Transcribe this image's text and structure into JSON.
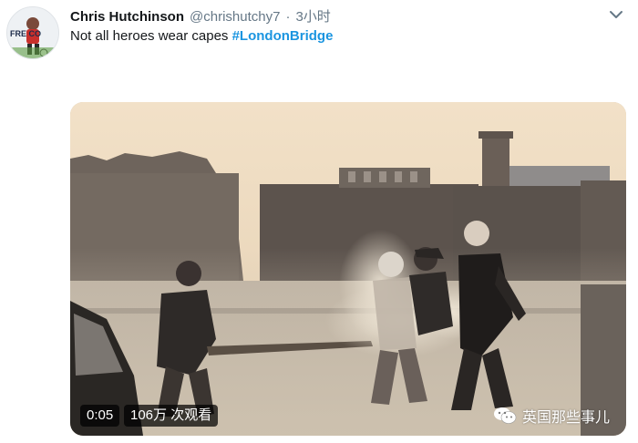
{
  "tweet": {
    "display_name": "Chris Hutchinson",
    "handle": "@chrishutchy7",
    "separator": "·",
    "timestamp": "3小时",
    "text": "Not all heroes wear capes ",
    "hashtag": "#LondonBridge"
  },
  "avatar": {
    "text": "FRE  CO"
  },
  "video": {
    "duration": "0:05",
    "views": "106万 次观看"
  },
  "watermark": {
    "text": "英国那些事儿",
    "icon": "wechat-icon"
  },
  "icons": {
    "menu": "chevron-down-icon"
  },
  "colors": {
    "hashtag": "#1b95e0",
    "name": "#14171a",
    "secondary": "#657786"
  }
}
